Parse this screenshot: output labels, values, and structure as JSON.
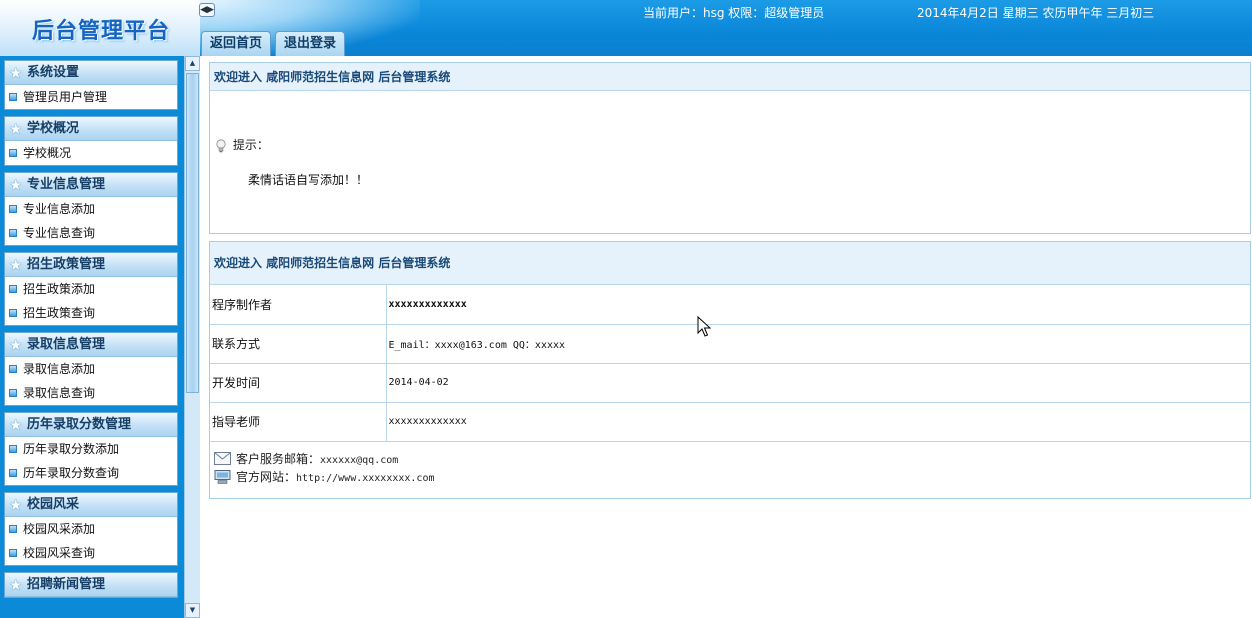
{
  "header": {
    "logo": "后台管理平台",
    "toggle_icon": "◀▶",
    "tabs": [
      {
        "label": "返回首页"
      },
      {
        "label": "退出登录"
      }
    ],
    "user_info": "当前用户：hsg 权限：超级管理员",
    "date_info": "2014年4月2日 星期三 农历甲午年 三月初三"
  },
  "sidebar": {
    "groups": [
      {
        "title": "系统设置",
        "items": [
          "管理员用户管理"
        ]
      },
      {
        "title": "学校概况",
        "items": [
          "学校概况"
        ]
      },
      {
        "title": "专业信息管理",
        "items": [
          "专业信息添加",
          "专业信息查询"
        ]
      },
      {
        "title": "招生政策管理",
        "items": [
          "招生政策添加",
          "招生政策查询"
        ]
      },
      {
        "title": "录取信息管理",
        "items": [
          "录取信息添加",
          "录取信息查询"
        ]
      },
      {
        "title": "历年录取分数管理",
        "items": [
          "历年录取分数添加",
          "历年录取分数查询"
        ]
      },
      {
        "title": "校园风采",
        "items": [
          "校园风采添加",
          "校园风采查询"
        ]
      },
      {
        "title": "招聘新闻管理",
        "items": []
      }
    ]
  },
  "welcome": {
    "title": "欢迎进入 咸阳师范招生信息网 后台管理系统",
    "tip_label": "提示：",
    "tip_content": "柔情话语自写添加！！"
  },
  "info": {
    "title": "欢迎进入 咸阳师范招生信息网 后台管理系统",
    "rows": [
      {
        "label": "程序制作者",
        "value": "xxxxxxxxxxxxx"
      },
      {
        "label": "联系方式",
        "value": "E_mail：xxxx@163.com QQ：xxxxx"
      },
      {
        "label": "开发时间",
        "value": "2014-04-02"
      },
      {
        "label": "指导老师",
        "value": "xxxxxxxxxxxxx"
      }
    ],
    "contact": {
      "email_label": "客户服务邮箱：",
      "email_value": "xxxxxx@qq.com",
      "site_label": "官方网站：",
      "site_value": "http://www.xxxxxxxx.com"
    }
  },
  "icons": {
    "group_icon": "star-icon",
    "item_icon": "square-bullet-icon",
    "tip_icon": "lightbulb-icon",
    "email_icon": "envelope-icon",
    "site_icon": "computer-icon"
  },
  "colors": {
    "header_blue": "#0a86d8",
    "sidebar_blue": "#0b8ad8",
    "panel_header_bg": "#e6f2fb",
    "border": "#a7cde8"
  }
}
